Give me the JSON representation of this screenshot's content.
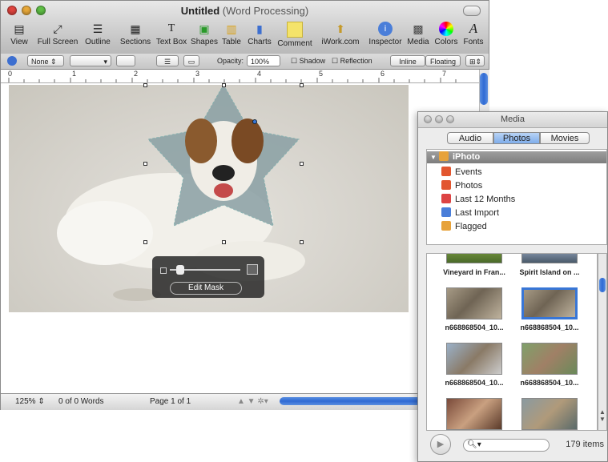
{
  "window": {
    "title": "Untitled",
    "subtitle": "(Word Processing)"
  },
  "toolbar": [
    "View",
    "Full Screen",
    "Outline",
    "Sections",
    "Text Box",
    "Shapes",
    "Table",
    "Charts",
    "Comment",
    "iWork.com",
    "Inspector",
    "Media",
    "Colors",
    "Fonts"
  ],
  "format_bar": {
    "style_value": "None",
    "opacity_label": "Opacity:",
    "opacity_value": "100%",
    "shadow_label": "Shadow",
    "reflection_label": "Reflection",
    "inline_label": "Inline",
    "floating_label": "Floating"
  },
  "ruler": [
    "0",
    "1",
    "2",
    "3",
    "4",
    "5",
    "6",
    "7"
  ],
  "status": {
    "zoom": "125%",
    "words": "0 of 0 Words",
    "page": "Page 1 of 1"
  },
  "mask_hud": {
    "edit_label": "Edit Mask"
  },
  "media": {
    "title": "Media",
    "tabs": [
      "Audio",
      "Photos",
      "Movies"
    ],
    "selected_tab": "Photos",
    "source": "iPhoto",
    "items": [
      "Events",
      "Photos",
      "Last 12 Months",
      "Last Import",
      "Flagged"
    ],
    "thumbs": [
      "Vineyard in Fran...",
      "Spirit Island on ...",
      "n668868504_10...",
      "n668868504_10...",
      "n668868504_10...",
      "n668868504_10...",
      "",
      ""
    ],
    "count": "179 items"
  },
  "colors": {
    "accent": "#3876d6"
  }
}
